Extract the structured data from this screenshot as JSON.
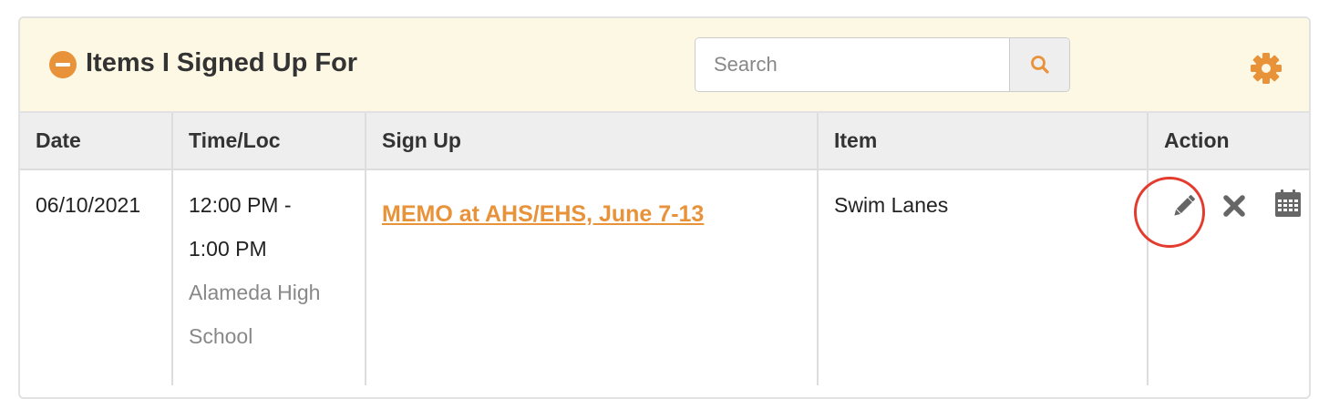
{
  "panel": {
    "title": "Items I Signed Up For",
    "collapse_icon": "minus-circle-icon",
    "settings_icon": "gear-icon",
    "accent_color": "#e8923a",
    "header_background": "#fcf8e3"
  },
  "search": {
    "placeholder": "Search",
    "value": "",
    "button_icon": "search-icon"
  },
  "table": {
    "columns": [
      "Date",
      "Time/Loc",
      "Sign Up",
      "Item",
      "Action"
    ],
    "rows": [
      {
        "date": "06/10/2021",
        "time_line1": "12:00 PM -",
        "time_line2": "1:00 PM",
        "location_line1": "Alameda High",
        "location_line2": "School",
        "signup": "MEMO at AHS/EHS, June 7-13",
        "item": "Swim Lanes",
        "actions": [
          "pencil-edit-icon",
          "close-x-icon",
          "calendar-icon"
        ]
      }
    ]
  },
  "annotation": {
    "highlight_color": "#e33b2e",
    "highlighted_action": "pencil-edit-icon"
  }
}
